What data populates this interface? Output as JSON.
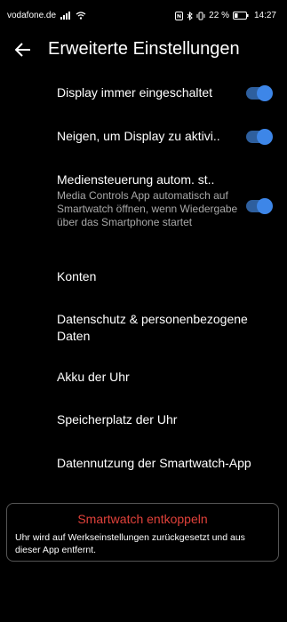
{
  "status": {
    "carrier": "vodafone.de",
    "battery_percent": "22 %",
    "time": "14:27"
  },
  "header": {
    "back_icon": "arrow-left-icon",
    "title": "Erweiterte Einstellungen"
  },
  "items": [
    {
      "title": "Display immer eingeschaltet",
      "toggle_on": true
    },
    {
      "title": "Neigen, um Display zu aktivi..",
      "toggle_on": true
    },
    {
      "title": "Mediensteuerung autom. st..",
      "subtitle": "Media Controls App automatisch auf Smartwatch öffnen, wenn Wiedergabe über das Smartphone startet",
      "toggle_on": true
    },
    {
      "title": "Konten"
    },
    {
      "title": "Datenschutz & personenbezogene Daten"
    },
    {
      "title": "Akku der Uhr"
    },
    {
      "title": "Speicherplatz der Uhr"
    },
    {
      "title": "Datennutzung der Smartwatch-App"
    }
  ],
  "footer": {
    "action_label": "Smartwatch entkoppeln",
    "note": "Uhr wird auf Werkseinstellungen zurückgesetzt und aus dieser App entfernt."
  },
  "colors": {
    "background": "#000000",
    "accent": "#3d86e8",
    "danger": "#e0413a",
    "secondary_text": "#a8a8a8"
  }
}
